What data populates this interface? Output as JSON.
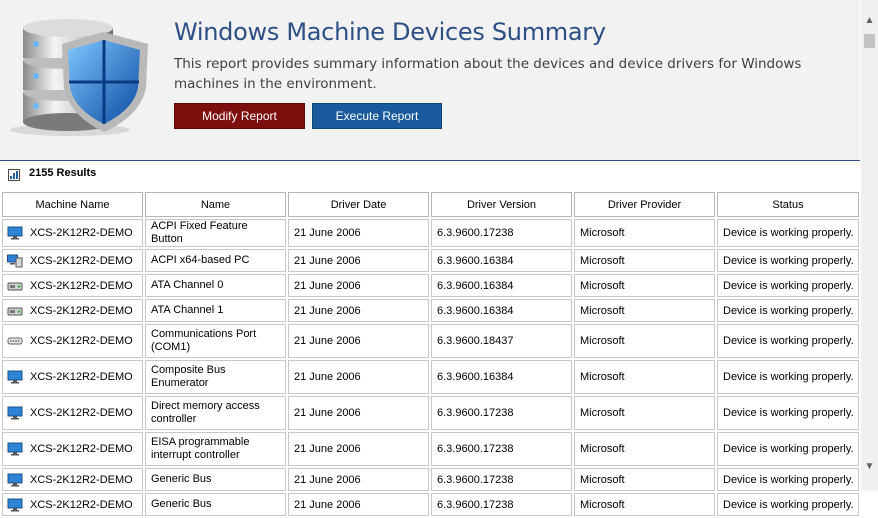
{
  "header": {
    "title": "Windows Machine Devices Summary",
    "description": "This report provides summary information about the devices and device drivers for Windows machines in the environment.",
    "modify_label": "Modify Report",
    "execute_label": "Execute Report",
    "logo_icon": "database-shield-icon"
  },
  "results": {
    "icon": "chart-icon",
    "count_label": "2155 Results"
  },
  "table": {
    "columns": [
      "Machine Name",
      "Name",
      "Driver Date",
      "Driver Version",
      "Driver Provider",
      "Status"
    ],
    "rows": [
      {
        "icon": "monitor-icon",
        "machine": "XCS-2K12R2-DEMO",
        "name": "ACPI Fixed Feature Button",
        "date": "21 June 2006",
        "version": "6.3.9600.17238",
        "provider": "Microsoft",
        "status": "Device is working properly."
      },
      {
        "icon": "computer-device-icon",
        "machine": "XCS-2K12R2-DEMO",
        "name": "ACPI x64-based PC",
        "date": "21 June 2006",
        "version": "6.3.9600.16384",
        "provider": "Microsoft",
        "status": "Device is working properly."
      },
      {
        "icon": "drive-controller-icon",
        "machine": "XCS-2K12R2-DEMO",
        "name": "ATA Channel 0",
        "date": "21 June 2006",
        "version": "6.3.9600.16384",
        "provider": "Microsoft",
        "status": "Device is working properly."
      },
      {
        "icon": "drive-controller-icon",
        "machine": "XCS-2K12R2-DEMO",
        "name": "ATA Channel 1",
        "date": "21 June 2006",
        "version": "6.3.9600.16384",
        "provider": "Microsoft",
        "status": "Device is working properly."
      },
      {
        "icon": "port-icon",
        "machine": "XCS-2K12R2-DEMO",
        "name": "Communications Port (COM1)",
        "date": "21 June 2006",
        "version": "6.3.9600.18437",
        "provider": "Microsoft",
        "status": "Device is working properly."
      },
      {
        "icon": "monitor-icon",
        "machine": "XCS-2K12R2-DEMO",
        "name": "Composite Bus Enumerator",
        "date": "21 June 2006",
        "version": "6.3.9600.16384",
        "provider": "Microsoft",
        "status": "Device is working properly."
      },
      {
        "icon": "monitor-icon",
        "machine": "XCS-2K12R2-DEMO",
        "name": "Direct memory access controller",
        "date": "21 June 2006",
        "version": "6.3.9600.17238",
        "provider": "Microsoft",
        "status": "Device is working properly."
      },
      {
        "icon": "monitor-icon",
        "machine": "XCS-2K12R2-DEMO",
        "name": "EISA programmable interrupt controller",
        "date": "21 June 2006",
        "version": "6.3.9600.17238",
        "provider": "Microsoft",
        "status": "Device is working properly."
      },
      {
        "icon": "monitor-icon",
        "machine": "XCS-2K12R2-DEMO",
        "name": "Generic Bus",
        "date": "21 June 2006",
        "version": "6.3.9600.17238",
        "provider": "Microsoft",
        "status": "Device is working properly."
      },
      {
        "icon": "monitor-icon",
        "machine": "XCS-2K12R2-DEMO",
        "name": "Generic Bus",
        "date": "21 June 2006",
        "version": "6.3.9600.17238",
        "provider": "Microsoft",
        "status": "Device is working properly."
      }
    ]
  },
  "scrollbar": {
    "up_icon": "scroll-up-arrow-icon",
    "down_icon": "scroll-down-arrow-icon"
  },
  "colors": {
    "title": "#2c4f85",
    "modify_button": "#7c0e0e",
    "execute_button": "#185a9c",
    "header_bg": "#f2f2f2"
  }
}
